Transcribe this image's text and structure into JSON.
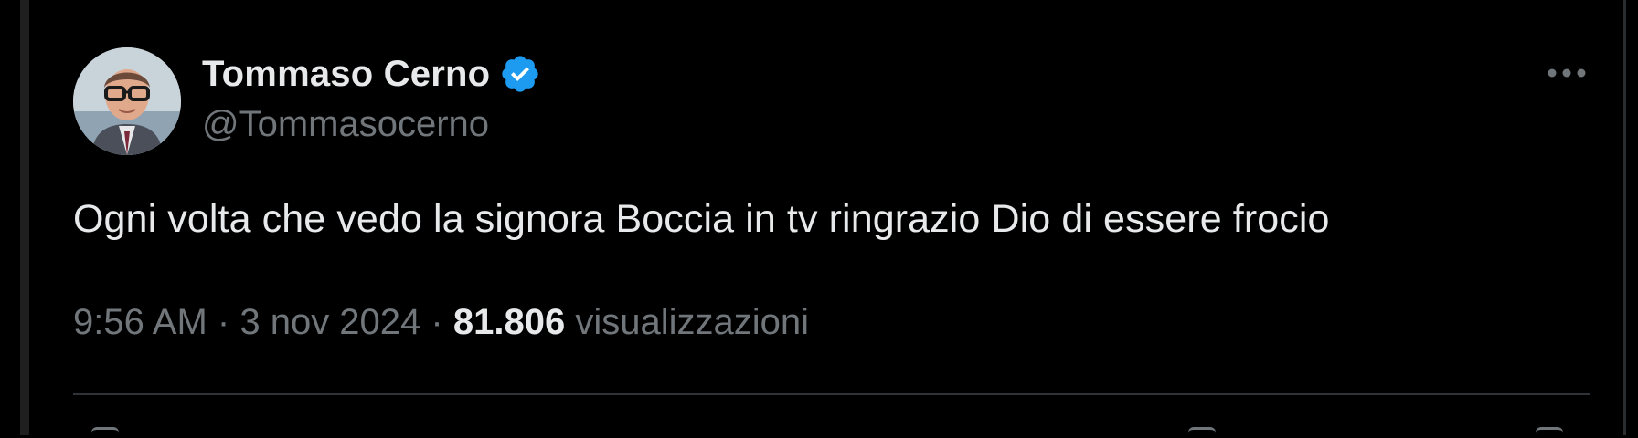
{
  "author": {
    "display_name": "Tommaso Cerno",
    "handle": "@Tommasocerno",
    "verified": true,
    "verified_badge_color": "#1d9bf0",
    "avatar_icon": "profile-photo"
  },
  "tweet": {
    "text": "Ogni volta che vedo la signora Boccia in tv ringrazio Dio di essere frocio",
    "time": "9:56 AM",
    "separator": "·",
    "date": "3 nov 2024",
    "views_count": "81.806",
    "views_label": "visualizzazioni"
  },
  "colors": {
    "background": "#000000",
    "text_primary": "#e7e9ea",
    "text_secondary": "#71767b",
    "divider": "#2f3336"
  }
}
